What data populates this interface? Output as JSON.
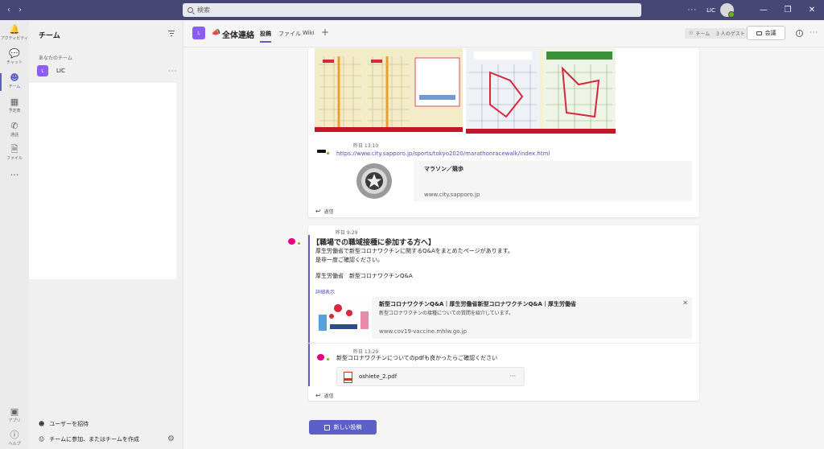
{
  "search": {
    "placeholder": "検索"
  },
  "titlebar": {
    "user": "LIC",
    "more": "···"
  },
  "rail": {
    "items": [
      {
        "label": "アクティビティ",
        "icon": "bell-icon"
      },
      {
        "label": "チャット",
        "icon": "chat-icon"
      },
      {
        "label": "チーム",
        "icon": "teams-icon"
      },
      {
        "label": "予定表",
        "icon": "calendar-icon"
      },
      {
        "label": "通話",
        "icon": "phone-icon"
      },
      {
        "label": "ファイル",
        "icon": "file-icon"
      }
    ],
    "more": "···",
    "apps_label": "アプリ",
    "help_label": "ヘルプ"
  },
  "panel": {
    "title": "チーム",
    "section": "あなたのチーム",
    "team": {
      "initial": "L",
      "name": "LIC"
    },
    "invite": "ユーザーを招待",
    "join": "チームに参加、またはチームを作成"
  },
  "channel": {
    "initial": "L",
    "title": "全体連絡",
    "tabs": [
      "投稿",
      "ファイル",
      "Wiki"
    ],
    "team_pill": "チーム",
    "guests_pill": "3 人のゲスト",
    "meet": "会議"
  },
  "post1": {
    "timestamp": "昨日 13:10",
    "link": "https://www.city.sapporo.jp/sports/tokyo2020/marathonracewalk/index.html",
    "preview_title": "マラソン／競歩",
    "preview_url": "www.city.sapporo.jp",
    "reply": "返信"
  },
  "post2": {
    "timestamp": "昨日 9:29",
    "heading": "【職場での職域接種に参加する方へ】",
    "line1": "厚生労働省で新型コロナワクチンに関するQ&Aをまとめたページがあります。",
    "line2": "是非一度ご確認ください。",
    "line3": "厚生労働省　新型コロナワクチンQ&A",
    "show_more": "詳細表示",
    "preview_title": "新型コロナワクチンQ&A｜厚生労働省新型コロナワクチンQ&A｜厚生労働省",
    "preview_desc": "新型コロナワクチンの接種についての質問を紹介しています。",
    "preview_url": "www.cov19-vaccine.mhlw.go.jp",
    "close": "✕",
    "reply_timestamp": "昨日 13:29",
    "reply_text": "新型コロナワクチンについてのpdfも良かったらご確認ください",
    "file_name": "oshiete_2.pdf",
    "file_more": "···",
    "reply": "返信"
  },
  "new_post": "新しい投稿",
  "colors": {
    "brand": "#5b5fc7",
    "titlebar": "#464775",
    "presence": "#6bb700"
  }
}
